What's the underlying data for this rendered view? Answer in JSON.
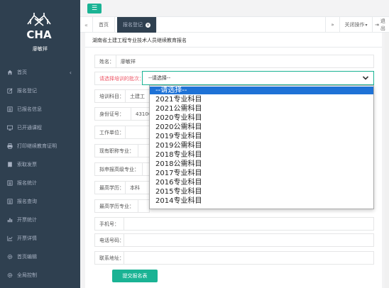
{
  "sidebar": {
    "logo_text": "CHA",
    "user_name": "廖敏祥",
    "items": [
      {
        "label": "首页",
        "icon": "home-icon",
        "has_chevron": true
      },
      {
        "label": "报名登记",
        "icon": "edit-icon"
      },
      {
        "label": "已报名信息",
        "icon": "list-icon"
      },
      {
        "label": "已开通课程",
        "icon": "monitor-icon"
      },
      {
        "label": "打印继续教育证明",
        "icon": "print-icon"
      },
      {
        "label": "索取发票",
        "icon": "receipt-icon"
      },
      {
        "label": "报名统计",
        "icon": "list-icon"
      },
      {
        "label": "报名查询",
        "icon": "list-icon"
      },
      {
        "label": "开票统计",
        "icon": "bar-chart-icon"
      },
      {
        "label": "开票详情",
        "icon": "chart-icon"
      },
      {
        "label": "首页编辑",
        "icon": "gear-icon"
      },
      {
        "label": "全局控制",
        "icon": "gear-icon"
      }
    ]
  },
  "tabs": {
    "home": "首页",
    "active": "报名登记",
    "close_ops": "关闭操作",
    "logout": "退出"
  },
  "form": {
    "title": "湖南省土建工程专业技术人员继续教育报名",
    "name_label": "姓名：",
    "name_value": "廖敏祥",
    "batch_label": "请选择培训的批次：",
    "select_value": "--请选择--",
    "subject_label": "培训科目：",
    "subject_value": "土建工",
    "id_label": "身份证号：",
    "id_value": "43100",
    "work_label": "工作单位：",
    "title_label": "现有职称专业：",
    "apply_label": "拟申报高级专业：",
    "edu_label": "最高学历：",
    "edu_value": "本科",
    "edu_major_label": "最高学历专业：",
    "phone_label": "手机号：",
    "tel_label": "电话号码：",
    "addr_label": "联系地址：",
    "submit_label": "提交报名表"
  },
  "dropdown_options": [
    "--请选择--",
    "2021专业科目",
    "2021公需科目",
    "2020专业科目",
    "2020公需科目",
    "2019专业科目",
    "2019公需科目",
    "2018专业科目",
    "2018公需科目",
    "2017专业科目",
    "2016专业科目",
    "2015专业科目",
    "2014专业科目"
  ],
  "colors": {
    "sidebar_bg": "#2f4050",
    "accent": "#1ab394",
    "required_label": "#ed5565",
    "dropdown_highlight": "#1e72d6"
  }
}
